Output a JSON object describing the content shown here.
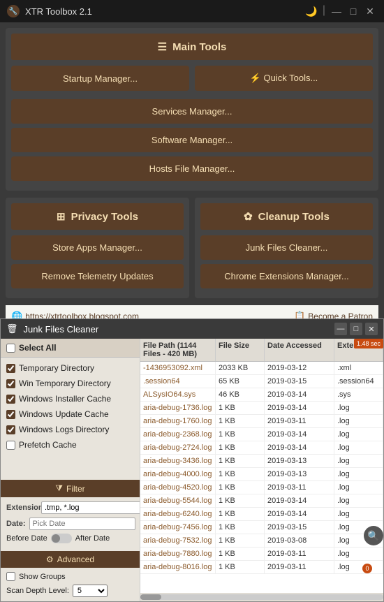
{
  "app": {
    "title": "XTR Toolbox 2.1",
    "icon": "🔧"
  },
  "titlebar": {
    "controls": {
      "moon": "🌙",
      "minimize": "—",
      "maximize": "□",
      "close": "✕"
    }
  },
  "main_tools": {
    "header": "Main Tools",
    "header_icon": "☰",
    "buttons": {
      "startup": "Startup Manager...",
      "quick": "Quick Tools...",
      "services": "Services Manager...",
      "software": "Software Manager...",
      "hosts": "Hosts File Manager..."
    }
  },
  "privacy_tools": {
    "header": "Privacy Tools",
    "header_icon": "⊞",
    "buttons": {
      "store_apps": "Store Apps Manager...",
      "remove_telemetry": "Remove Telemetry Updates"
    }
  },
  "cleanup_tools": {
    "header": "Cleanup Tools",
    "header_icon": "✿",
    "buttons": {
      "junk": "Junk Files Cleaner...",
      "chrome": "Chrome Extensions Manager..."
    }
  },
  "links": {
    "blog": "https://xtrtoolbox.blogspot.com",
    "patron": "Become a Patron"
  },
  "junk_cleaner": {
    "title": "Junk Files Cleaner",
    "header_info": "File Path (1144 Files - 420 MB)",
    "columns": {
      "filepath": "File Path (1144 Files - 420 MB)",
      "filesize": "File Size",
      "date": "Date Accessed",
      "ext": "Extension"
    },
    "select_all": "Select All",
    "checkboxes": [
      {
        "label": "Temporary Directory",
        "checked": true
      },
      {
        "label": "Win Temporary Directory",
        "checked": true
      },
      {
        "label": "Windows Installer Cache",
        "checked": true
      },
      {
        "label": "Windows Update Cache",
        "checked": true
      },
      {
        "label": "Windows Logs Directory",
        "checked": true
      },
      {
        "label": "Prefetch Cache",
        "checked": false
      }
    ],
    "filter": {
      "header": "Filter",
      "extension_label": "Extension:",
      "extension_value": ".tmp, *.log",
      "date_label": "Date:",
      "date_placeholder": "Pick Date",
      "before_label": "Before Date",
      "after_label": "After Date"
    },
    "advanced": {
      "header": "Advanced",
      "show_groups_label": "Show Groups",
      "scan_depth_label": "Scan Depth Level:",
      "scan_depth_value": "5"
    },
    "files": [
      {
        "path": "-1436953092.xml",
        "size": "2033 KB",
        "date": "2019-03-12",
        "ext": ".xml"
      },
      {
        "path": ".session64",
        "size": "65 KB",
        "date": "2019-03-15",
        "ext": ".session64"
      },
      {
        "path": "ALSysIO64.sys",
        "size": "46 KB",
        "date": "2019-03-14",
        "ext": ".sys"
      },
      {
        "path": "aria-debug-1736.log",
        "size": "1 KB",
        "date": "2019-03-14",
        "ext": ".log"
      },
      {
        "path": "aria-debug-1760.log",
        "size": "1 KB",
        "date": "2019-03-11",
        "ext": ".log"
      },
      {
        "path": "aria-debug-2368.log",
        "size": "1 KB",
        "date": "2019-03-14",
        "ext": ".log"
      },
      {
        "path": "aria-debug-2724.log",
        "size": "1 KB",
        "date": "2019-03-14",
        "ext": ".log"
      },
      {
        "path": "aria-debug-3436.log",
        "size": "1 KB",
        "date": "2019-03-13",
        "ext": ".log"
      },
      {
        "path": "aria-debug-4000.log",
        "size": "1 KB",
        "date": "2019-03-13",
        "ext": ".log"
      },
      {
        "path": "aria-debug-4520.log",
        "size": "1 KB",
        "date": "2019-03-11",
        "ext": ".log"
      },
      {
        "path": "aria-debug-5544.log",
        "size": "1 KB",
        "date": "2019-03-14",
        "ext": ".log"
      },
      {
        "path": "aria-debug-6240.log",
        "size": "1 KB",
        "date": "2019-03-14",
        "ext": ".log"
      },
      {
        "path": "aria-debug-7456.log",
        "size": "1 KB",
        "date": "2019-03-15",
        "ext": ".log"
      },
      {
        "path": "aria-debug-7532.log",
        "size": "1 KB",
        "date": "2019-03-08",
        "ext": ".log"
      },
      {
        "path": "aria-debug-7880.log",
        "size": "1 KB",
        "date": "2019-03-11",
        "ext": ".log"
      },
      {
        "path": "aria-debug-8016.log",
        "size": "1 KB",
        "date": "2019-03-11",
        "ext": ".log"
      }
    ],
    "time_badge": "1.48 sec"
  }
}
